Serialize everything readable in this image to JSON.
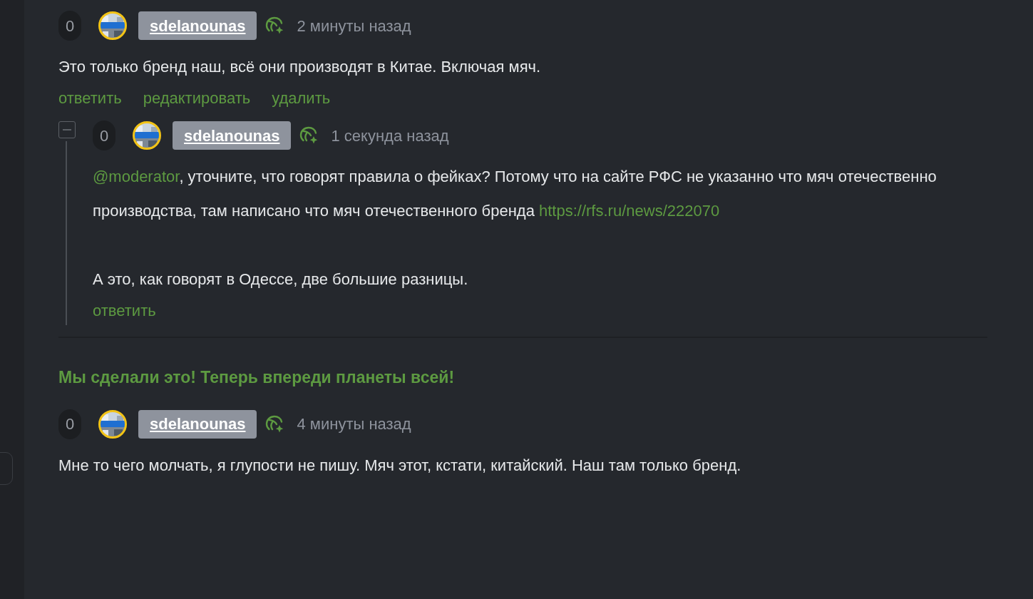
{
  "comments": [
    {
      "score": "0",
      "username": "sdelanounas",
      "time": "2 минуты назад",
      "paragraphs": [
        [
          {
            "kind": "text",
            "text": "Это только бренд наш, всё они производят в Китае. Включая мяч."
          }
        ]
      ],
      "actions": [
        "ответить",
        "редактировать",
        "удалить"
      ],
      "replies": [
        {
          "score": "0",
          "username": "sdelanounas",
          "time": "1 секунда назад",
          "expanded": true,
          "paragraphs": [
            [
              {
                "kind": "link",
                "text": "@moderator"
              },
              {
                "kind": "text",
                "text": ", уточните, что говорят правила о фейках? Потому что на сайте РФС не указанно что мяч отечественно производства, там написано что мяч отечественного бренда "
              },
              {
                "kind": "link",
                "text": "https://rfs.ru/news/222070"
              }
            ],
            [
              {
                "kind": "text",
                "text": "А это, как говорят в Одессе, две большие разницы."
              }
            ]
          ],
          "actions": [
            "ответить"
          ]
        }
      ]
    }
  ],
  "post_title": "Мы сделали это! Теперь впереди планеты всей!",
  "post_comments": [
    {
      "score": "0",
      "username": "sdelanounas",
      "time": "4 минуты назад",
      "paragraphs": [
        [
          {
            "kind": "text",
            "text": "Мне то чего молчать, я глупости не пишу. Мяч этот, кстати, китайский. Наш там только бренд."
          }
        ]
      ]
    }
  ]
}
